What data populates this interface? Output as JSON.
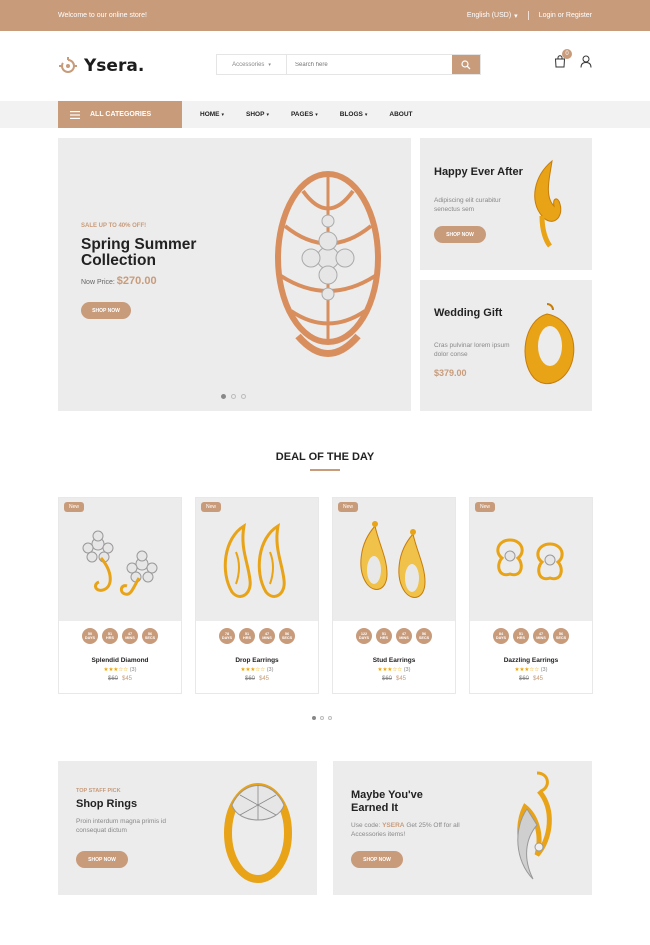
{
  "topbar": {
    "welcome": "Welcome to our online store!",
    "language": "English (USD)",
    "login": "Login or Register"
  },
  "header": {
    "logo_text": "Ysera.",
    "search_category": "Accessories",
    "search_placeholder": "Search here",
    "cart_count": "0"
  },
  "nav": {
    "all_categories": "ALL CATEGORIES",
    "items": [
      {
        "label": "HOME"
      },
      {
        "label": "SHOP"
      },
      {
        "label": "PAGES"
      },
      {
        "label": "BLOGS"
      },
      {
        "label": "ABOUT"
      }
    ]
  },
  "hero": {
    "eyebrow": "SALE UP TO 40% OFF!",
    "title": "Spring Summer Collection",
    "price_label": "Now Price:",
    "price": "$270.00",
    "button": "SHOP NOW"
  },
  "side_banners": [
    {
      "title": "Happy Ever After",
      "text": "Adipiscing elit curabitur senectus sem",
      "button": "SHOP NOW"
    },
    {
      "title": "Wedding Gift",
      "text": "Cras pulvinar lorem ipsum dolor conse",
      "price": "$379.00"
    }
  ],
  "deal": {
    "title": "DEAL OF THE DAY",
    "timer_units": [
      "DAYS",
      "HRS",
      "MINS",
      "SECS"
    ],
    "products": [
      {
        "badge": "New",
        "name": "Splendid Diamond",
        "timer": [
          "50",
          "51",
          "47",
          "56"
        ],
        "stars": "★★★☆☆",
        "reviews": "(3)",
        "old_price": "$60",
        "price": "$45"
      },
      {
        "badge": "New",
        "name": "Drop Earrings",
        "timer": [
          "78",
          "51",
          "47",
          "56"
        ],
        "stars": "★★★☆☆",
        "reviews": "(3)",
        "old_price": "$60",
        "price": "$45"
      },
      {
        "badge": "New",
        "name": "Stud Earrings",
        "timer": [
          "122",
          "51",
          "47",
          "56"
        ],
        "stars": "★★★☆☆",
        "reviews": "(3)",
        "old_price": "$60",
        "price": "$45"
      },
      {
        "badge": "New",
        "name": "Dazzling Earrings",
        "timer": [
          "84",
          "51",
          "47",
          "56"
        ],
        "stars": "★★★☆☆",
        "reviews": "(3)",
        "old_price": "$60",
        "price": "$45"
      }
    ]
  },
  "banners": [
    {
      "eyebrow": "TOP STAFF PICK",
      "title": "Shop Rings",
      "text": "Proin interdum magna primis id consequat dictum",
      "button": "SHOP NOW"
    },
    {
      "title": "Maybe You've Earned It",
      "text_before": "Use code:",
      "code": "YSERA",
      "text_after": "Get 25% Off for all Accessories items!",
      "button": "SHOP NOW"
    }
  ],
  "colors": {
    "accent": "#c89b7b",
    "panel": "#ececec",
    "gold": "#e8a317",
    "rose_gold": "#d98e5e"
  }
}
